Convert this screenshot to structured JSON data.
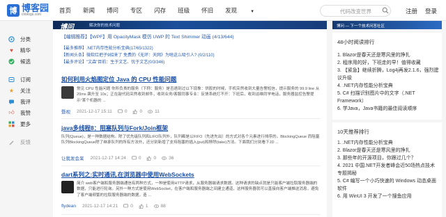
{
  "header": {
    "logo_cn": "博客园",
    "logo_en": "cnblogs.com",
    "nav": [
      "首页",
      "新闻",
      "博问",
      "专区",
      "闪存",
      "班级",
      "怀旧",
      "发现"
    ],
    "search_placeholder": "代码改变世界",
    "register": "注册",
    "login": "登录"
  },
  "banner": {
    "brand": "博问",
    "slogan": "解决你的技术问题",
    "right_text": "博问 — 下一个技术问答社区"
  },
  "sidebar": {
    "items": [
      {
        "label": "分类",
        "icon": "category-icon"
      },
      {
        "label": "精华",
        "icon": "essence-icon"
      },
      {
        "label": "候选",
        "icon": "candidate-icon"
      },
      {
        "label": "订阅",
        "icon": "subscribe-icon"
      },
      {
        "label": "关注",
        "icon": "follow-icon"
      },
      {
        "label": "我评",
        "icon": "my-comment-icon"
      },
      {
        "label": "我赞",
        "icon": "my-like-icon"
      },
      {
        "label": "更多",
        "icon": "more-icon"
      },
      {
        "label": "反馈",
        "icon": "feedback-icon"
      }
    ]
  },
  "announcements": [
    "【编辑推荐】【WPF】用 OpacityMask 模仿 UWP 的 Text Shimmer 动画 (4/13/644)",
    "【最多推荐】.NET内存性能分析宝典(17/65/1322)",
    "【新闻头条】微软红把子9招来了 免费的《无环：天网》为啥这么吸引人? (0/2/110)",
    "【最多评论】\"文森\"目前：生于文艺、忧于文艺(0/3/346)"
  ],
  "posts": [
    {
      "title": "如何利用火焰图定位 Java 的 CPU 性能问题",
      "summary": "常见 CPU 性能问题 你所负责的服务（下称：服务）是否遇到过以下现象：供股的时候，手机突然收到大量告警短信，提示服务的 99.9 line 从 20ms 飙升至 10s；正在敲代码突然收到邮件，收到业务/客服同事专业：反馈系统打不开：下班后，收到运维同学电话，服务器监控告警提示\"某个机器的 ...",
      "author": "暨视",
      "date": "2021-12-17 15:11",
      "comments": "0",
      "likes": "0",
      "views": "11"
    },
    {
      "title": "java多线程8：阻塞队列与Fork/Join框架",
      "summary": "队列(Queue)，是一种数据结构。除了优先级队列和LIFO队列外，队列都是以FIFO（先进先出）的方式对各个元素进行排序的。BlockingQueue 而阻塞队列BlockingQueue除了继承队列的所有方法外，还分别新增了支持阻塞的插入(put)和移除(take)方法。下面我们分别看下JD ...",
      "author": "让我发会呆",
      "date": "2021-12-17 14:24",
      "comments": "0",
      "likes": "0",
      "views": "36"
    },
    {
      "title": "dart系列之:实时通讯,在浏览器中使用WebSockets",
      "summary": "简介 web客户端和服务器端通信有两种方式，一种是使用HTTP请求，从服务器端请求数据。这种请求的缺点就是只能客户端拉取服务器端的数据，只能进行轮询。另外一种方式是使用WebSocket，在客户端和服务器端之间建立通道，这样服务器就可以直接向客户端推送消息，避免了客户端频繁的拉取服务器端的数据，造 ...",
      "author": "flydean",
      "date": "2021-12-17 14:21",
      "comments": "0",
      "likes": "1",
      "views": "88"
    }
  ],
  "panels": {
    "hot48": {
      "title": "48小时阅读排行",
      "items": [
        "1. Blazor是春天还是寒风里的挣扎",
        "2. 程序用的好，下班走的早！值得收藏",
        "3. 【紧急】继续折腾，Log4j再发2.1.6，强烈建议升级",
        "4. .NET内存性能分析宝典",
        "5. C# 扫描识别图片中的文字（.NET Framework）",
        "6. 学Java，Java书籍的最佳阅读顺序"
      ]
    },
    "hot10": {
      "title": "10天推荐排行",
      "items": [
        "1. .NET内存性能分析宝典",
        "2. Blazor是春天还是寒风里的挣扎",
        "3. 那些年的开源项目，你跟过几个？",
        "4. 2021 中国.NET开发者峰会近50场热点技术专题揭秘",
        "5. C# 编写一个小巧快速的 Windows 动态桌面软件",
        "6. 用 WinUI 3 开发了一个搜鱼应用"
      ]
    }
  }
}
